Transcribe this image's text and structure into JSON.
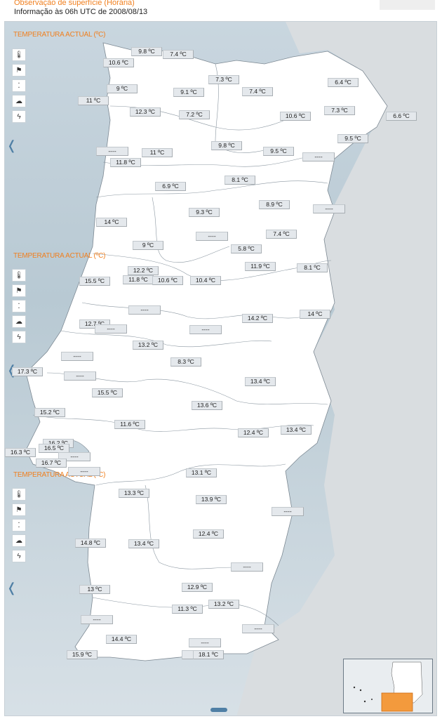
{
  "header": {
    "title": "Observação de superfície (Horária)",
    "subtitle": "Informação às 06h UTC de 2008/08/13"
  },
  "sections": [
    {
      "title": "TEMPERATURA ACTUAL (ºC)"
    },
    {
      "title": "TEMPERATURA ACTUAL (ºC)"
    },
    {
      "title": "TEMPERATURA ACTUAL (ºC)"
    }
  ],
  "icons": [
    "thermometer-icon",
    "wind-sock-icon",
    "rain-icon",
    "cloud-icon",
    "lightning-icon"
  ],
  "colors": {
    "accent": "#f07f1e",
    "land": "#ffffff",
    "sea": "#c5d3dc",
    "border": "#8a96a0"
  },
  "stations": [
    {
      "v": "9.8 ºC"
    },
    {
      "v": "7.4 ºC"
    },
    {
      "v": "10.6 ºC"
    },
    {
      "v": "7.3 ºC"
    },
    {
      "v": "6.4 ºC"
    },
    {
      "v": "9 ºC"
    },
    {
      "v": "9.1 ºC"
    },
    {
      "v": "7.4 ºC"
    },
    {
      "v": "11 ºC"
    },
    {
      "v": "12.3 ºC"
    },
    {
      "v": "7.2 ºC"
    },
    {
      "v": "10.6 ºC"
    },
    {
      "v": "7.3 ºC"
    },
    {
      "v": "6.6 ºC"
    },
    {
      "v": "9.5 ºC"
    },
    {
      "v": "9.8 ºC"
    },
    {
      "v": "9.5 ºC"
    },
    {
      "v": "----"
    },
    {
      "v": "11 ºC"
    },
    {
      "v": "----"
    },
    {
      "v": "11.8 ºC"
    },
    {
      "v": "8.1 ºC"
    },
    {
      "v": "6.9 ºC"
    },
    {
      "v": "8.9 ºC"
    },
    {
      "v": "9.3 ºC"
    },
    {
      "v": "----"
    },
    {
      "v": "14 ºC"
    },
    {
      "v": "----"
    },
    {
      "v": "7.4 ºC"
    },
    {
      "v": "9 ºC"
    },
    {
      "v": "5.8 ºC"
    },
    {
      "v": "11.9 ºC"
    },
    {
      "v": "8.1 ºC"
    },
    {
      "v": "12.2 ºC"
    },
    {
      "v": "15.5 ºC"
    },
    {
      "v": "11.8 ºC"
    },
    {
      "v": "10.6 ºC"
    },
    {
      "v": "10.4 ºC"
    },
    {
      "v": "----"
    },
    {
      "v": "14 ºC"
    },
    {
      "v": "14.2 ºC"
    },
    {
      "v": "12.7 ºC"
    },
    {
      "v": "----"
    },
    {
      "v": "----"
    },
    {
      "v": "13.2 ºC"
    },
    {
      "v": "----"
    },
    {
      "v": "8.3 ºC"
    },
    {
      "v": "17.3 ºC"
    },
    {
      "v": "----"
    },
    {
      "v": "13.4 ºC"
    },
    {
      "v": "15.5 ºC"
    },
    {
      "v": "15.2 ºC"
    },
    {
      "v": "13.6 ºC"
    },
    {
      "v": "11.6 ºC"
    },
    {
      "v": "12.4 ºC"
    },
    {
      "v": "13.4 ºC"
    },
    {
      "v": "16.2 ºC"
    },
    {
      "v": "16.5 ºC"
    },
    {
      "v": "16.3 ºC"
    },
    {
      "v": "----"
    },
    {
      "v": "16.7 ºC"
    },
    {
      "v": "----"
    },
    {
      "v": "13.1 ºC"
    },
    {
      "v": "13.3 ºC"
    },
    {
      "v": "13.9 ºC"
    },
    {
      "v": "----"
    },
    {
      "v": "14.8 ºC"
    },
    {
      "v": "13.4 ºC"
    },
    {
      "v": "12.4 ºC"
    },
    {
      "v": "----"
    },
    {
      "v": "13 ºC"
    },
    {
      "v": "12.9 ºC"
    },
    {
      "v": "11.3 ºC"
    },
    {
      "v": "13.2 ºC"
    },
    {
      "v": "----"
    },
    {
      "v": "----"
    },
    {
      "v": "14.4 ºC"
    },
    {
      "v": "----"
    },
    {
      "v": "----"
    },
    {
      "v": "15.9 ºC"
    },
    {
      "v": "18.1 ºC"
    }
  ]
}
